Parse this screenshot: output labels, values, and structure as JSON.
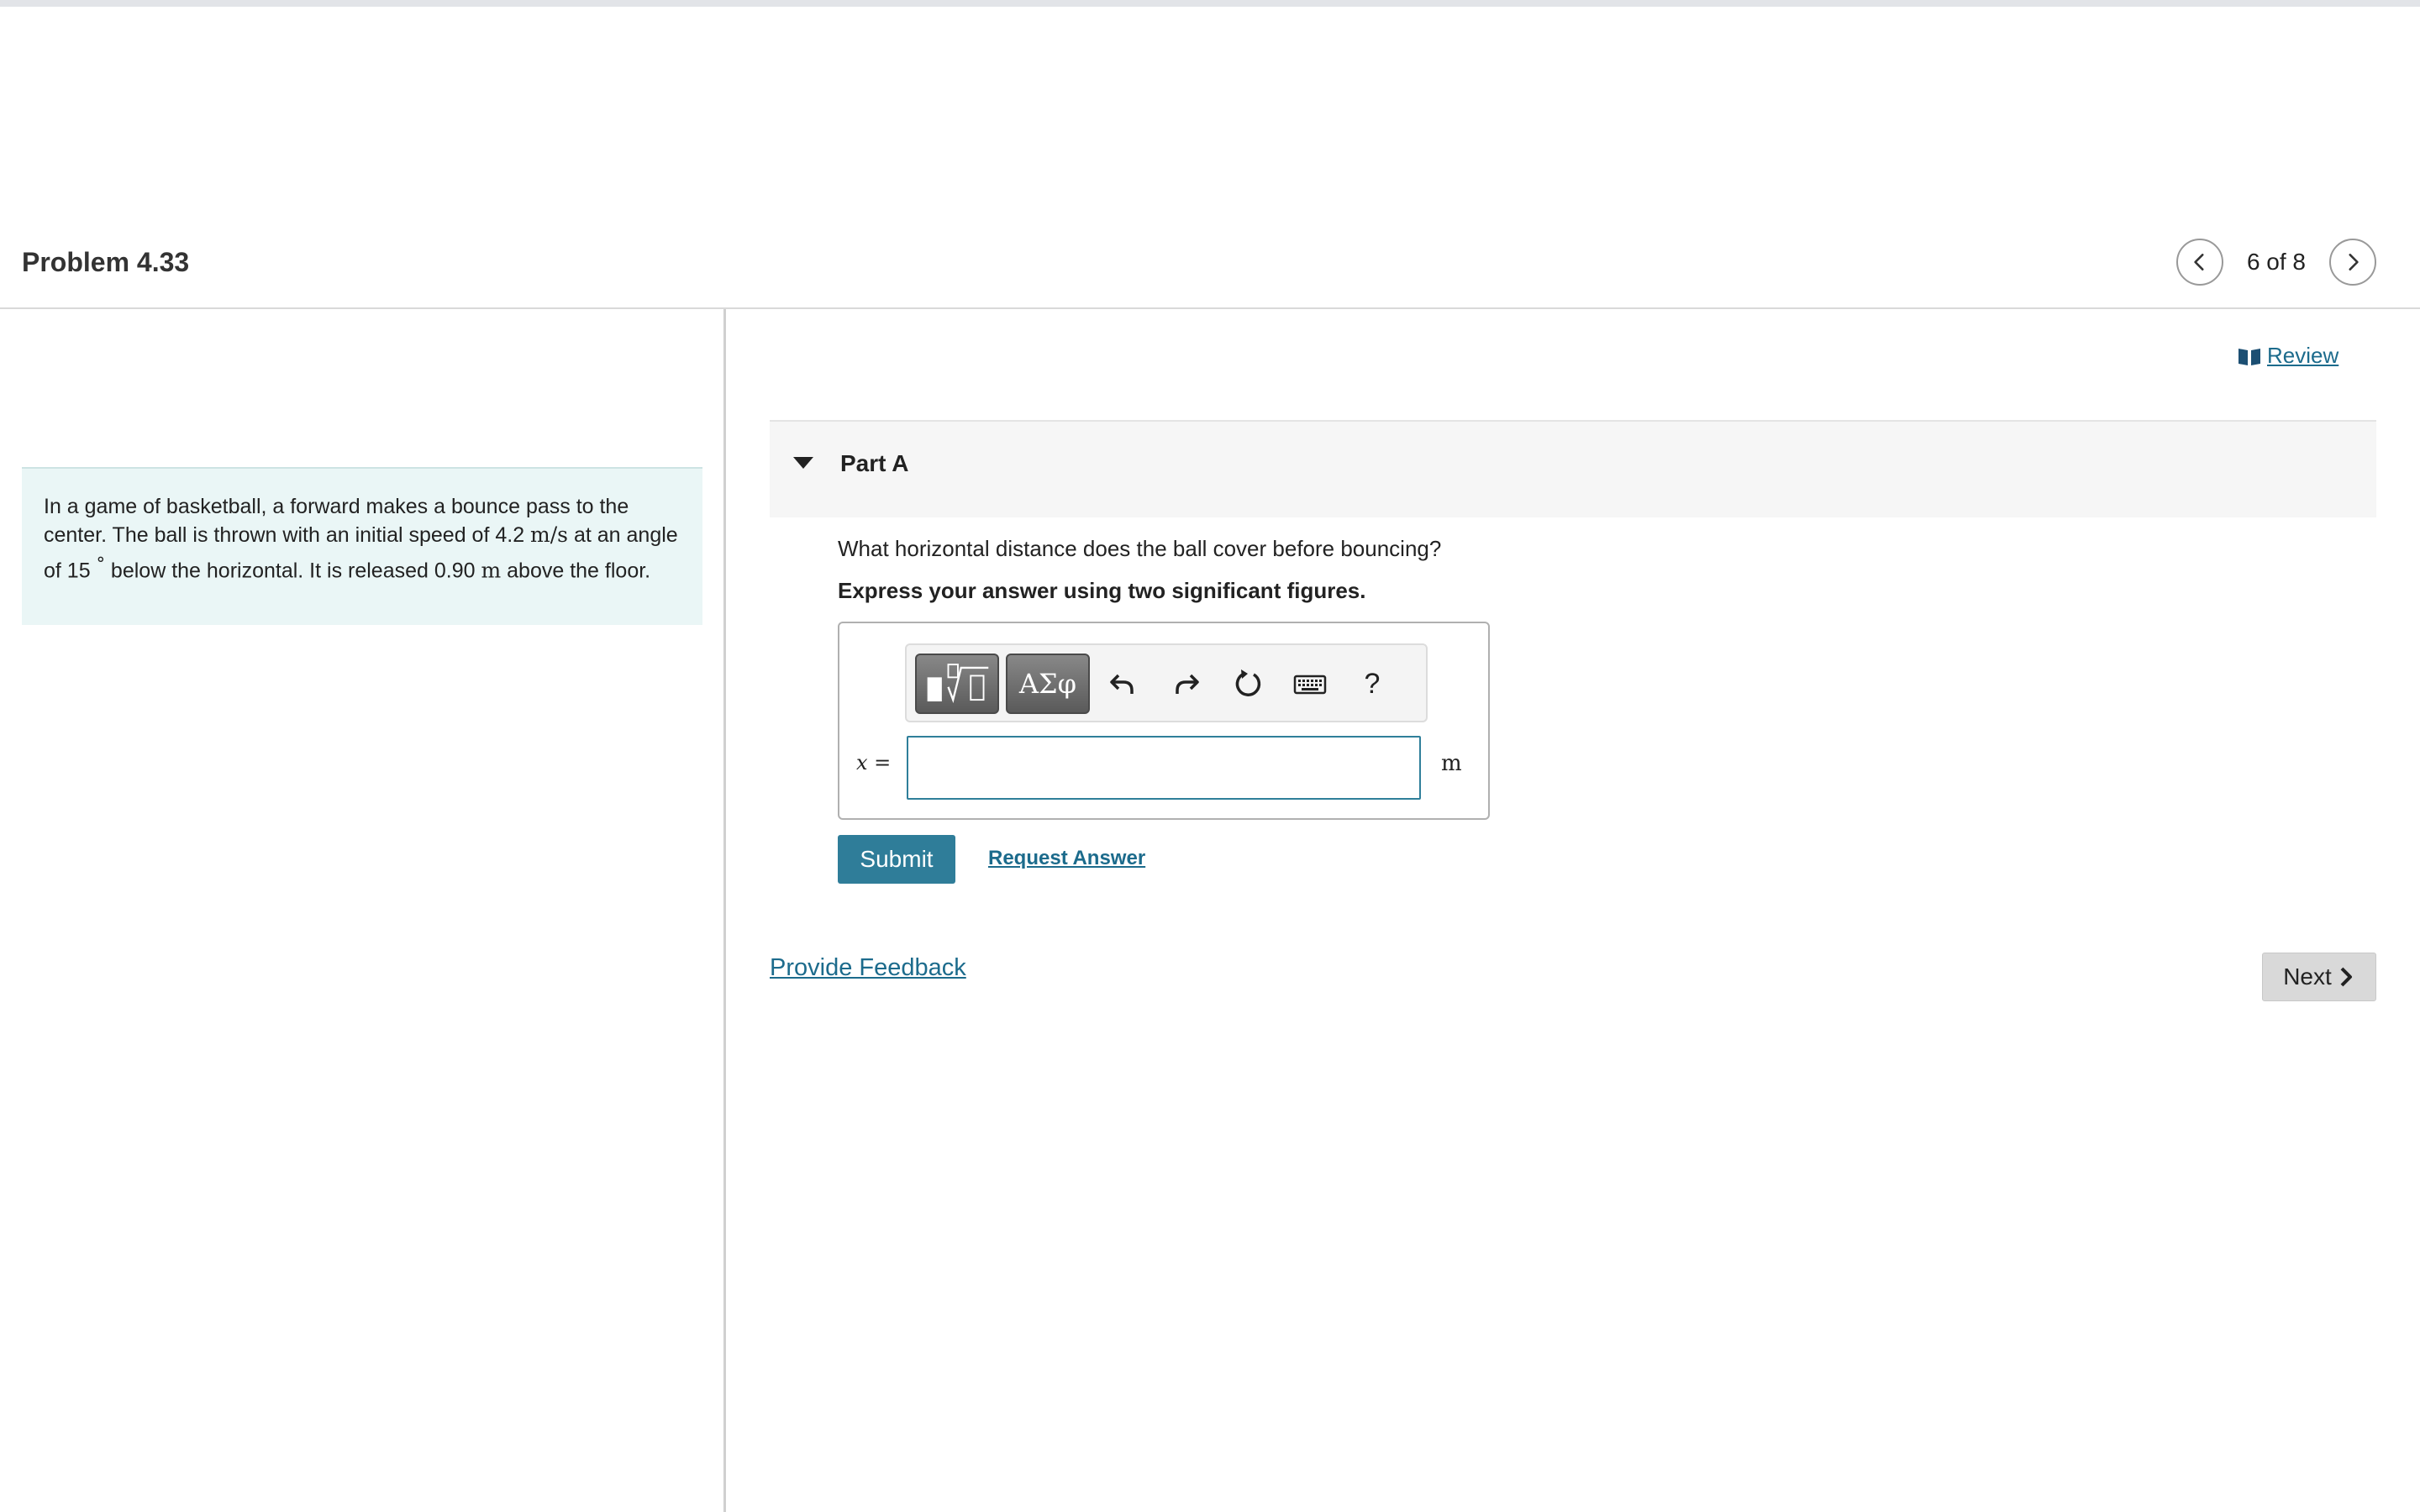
{
  "header": {
    "problem_title": "Problem 4.33",
    "page_indicator": "6 of 8"
  },
  "problem": {
    "text_1": "In a game of basketball, a forward makes a bounce pass to the center. The ball is thrown with an initial speed of 4.2 ",
    "speed_unit": "m/s",
    "text_2": " at an angle of 15 ",
    "degree_symbol": "°",
    "text_3": " below the horizontal. It is released 0.90 ",
    "height_unit": "m",
    "text_4": " above the floor."
  },
  "review": {
    "label": " Review"
  },
  "part": {
    "title": "Part A",
    "question": "What horizontal distance does the ball cover before bouncing?",
    "instruction": "Express your answer using two significant figures."
  },
  "toolbar": {
    "greek_label": "ΑΣφ",
    "help_label": "?"
  },
  "answer": {
    "variable_label": "x =",
    "value": "",
    "placeholder": "",
    "unit": "m"
  },
  "actions": {
    "submit_label": "Submit",
    "request_answer_label": "Request Answer",
    "feedback_label": "Provide Feedback",
    "next_label": "Next"
  },
  "colors": {
    "accent": "#2f7d99",
    "link": "#1c6b8c",
    "problem_bg": "#eaf6f6"
  }
}
